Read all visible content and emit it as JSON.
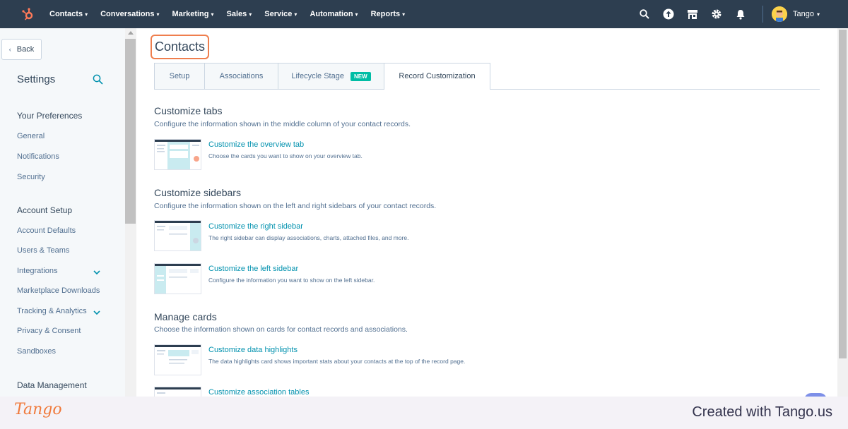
{
  "nav": {
    "items": [
      {
        "label": "Contacts"
      },
      {
        "label": "Conversations"
      },
      {
        "label": "Marketing"
      },
      {
        "label": "Sales"
      },
      {
        "label": "Service"
      },
      {
        "label": "Automation"
      },
      {
        "label": "Reports"
      }
    ],
    "account_name": "Tango",
    "colors": {
      "bg": "#2d3e50",
      "logo": "#ff7a59"
    },
    "icons": [
      "search-icon",
      "upgrade-icon",
      "marketplace-icon",
      "gear-icon",
      "bell-icon"
    ]
  },
  "sidebar": {
    "back_label": "Back",
    "title": "Settings",
    "sections": [
      {
        "label": "Your Preferences",
        "items": [
          "General",
          "Notifications",
          "Security"
        ]
      },
      {
        "label": "Account Setup",
        "items": [
          "Account Defaults",
          "Users & Teams",
          "Integrations",
          "Marketplace Downloads",
          "Tracking & Analytics",
          "Privacy & Consent",
          "Sandboxes"
        ]
      },
      {
        "label": "Data Management",
        "items": []
      }
    ]
  },
  "main": {
    "title": "Contacts",
    "tabs": [
      {
        "label": "Setup"
      },
      {
        "label": "Associations"
      },
      {
        "label": "Lifecycle Stage",
        "badge": "NEW"
      },
      {
        "label": "Record Customization"
      }
    ],
    "sections": [
      {
        "title": "Customize tabs",
        "description": "Configure the information shown in the middle column of your contact records.",
        "items": [
          {
            "link": "Customize the overview tab",
            "description": "Choose the cards you want to show on your overview tab."
          }
        ]
      },
      {
        "title": "Customize sidebars",
        "description": "Configure the information shown on the left and right sidebars of your contact records.",
        "items": [
          {
            "link": "Customize the right sidebar",
            "description": "The right sidebar can display associations, charts, attached files, and more."
          },
          {
            "link": "Customize the left sidebar",
            "description": "Configure the information you want to show on the left sidebar."
          }
        ]
      },
      {
        "title": "Manage cards",
        "description": "Choose the information shown on cards for contact records and associations.",
        "items": [
          {
            "link": "Customize data highlights",
            "description": "The data highlights card shows important stats about your contacts at the top of the record page."
          },
          {
            "link": "Customize association tables",
            "description": ""
          }
        ]
      }
    ]
  },
  "footer": {
    "logo": "Tango",
    "credit": "Created with Tango.us"
  }
}
